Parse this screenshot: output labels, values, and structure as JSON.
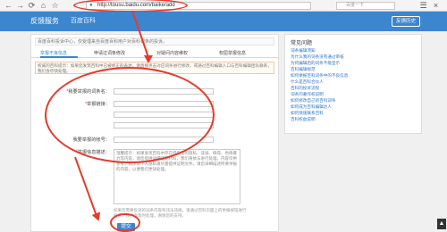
{
  "browser": {
    "url": "http://tousu.baidu.com/baike/add",
    "search_placeholder": "百度一下"
  },
  "header": {
    "brand": "反馈服务",
    "section": "百度百科",
    "feedback_button": "反馈历史"
  },
  "notice": "百度百科投诉中心，仅受理来自百度百科用户对百科词条的投诉。",
  "tabs": [
    "举报不良信息",
    "申请过词条修改",
    "对疑问内容维权",
    "权屈举报信息"
  ],
  "info_text": "权威的百科提示：如果您发现百科中已被修正的表述，请直接点击对应词条进行修改，或通过百科编辑入口与百科编辑团队联系，我们会尽快处理。",
  "form": {
    "name_label": "我要举报的词条名：",
    "link_label": "举报链接：",
    "account_label": "我要举报的帐号：",
    "desc_label": "举报信息描述：",
    "desc_placeholder": "温馨提示：如果发现百科中存在侵犯您的隐私、诽谤、侮辱、色情暴力等内容，请您提供详细证明材料，我们将依法进行处理。内容仅供参考，如涉及个人隐私请尽量提供证明文件。请您详细描述所要举报的内容，以便我们更快处理。",
    "hint": "如果您需要投诉的词条内容有违法违规，请通过百科页面上的举报按钮进行投诉，我们会及时处理，谢谢您的支持。",
    "submit": "提交"
  },
  "sidebar": {
    "title": "常见问题",
    "faqs": [
      "词条编辑须知",
      "为什么我的词条没有通过审核",
      "为何编辑后的词条不能显示",
      "百科编辑规范",
      "如何举报百科词条中的不良信息",
      "什么是百科合伙人",
      "百科的投诉流程",
      "词条的著作权说明",
      "如何修改自己的百科词条",
      "如何成为百科编辑达人",
      "如何快速联系百科",
      "百科权益说明"
    ]
  }
}
